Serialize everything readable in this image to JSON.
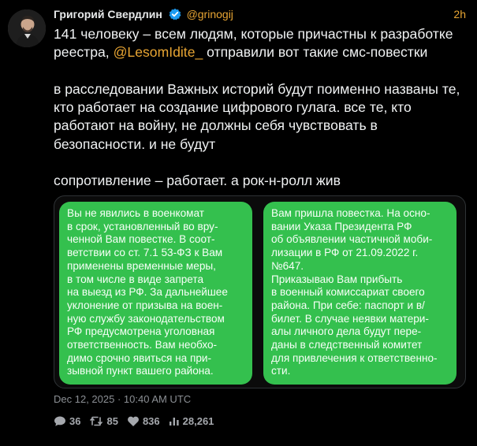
{
  "tweet": {
    "author_name": "Григорий Свердлин",
    "handle": "@grinogij",
    "time_ago": "2h",
    "text_line1_before_mention": "141 человеку – всем людям, которые причастны к разработке реестра, ",
    "mention": "@LesomIdite_",
    "text_line1_after_mention": " отправили вот такие смс-повестки",
    "paragraph2": "в расследовании Важных историй будут поименно названы те, кто работает на создание цифрового гулага. все те, кто работают на войну, не должны себя чувствовать в безопасности. и не будут",
    "paragraph3": "сопротивление – работает. а рок-н-ролл жив",
    "timestamp": "Dec 12, 2025 · 10:40 AM UTC",
    "stats": {
      "replies": "36",
      "retweets": "85",
      "likes": "836",
      "views": "28,261"
    }
  },
  "media": {
    "sms_left": "Вы не явились в военкомат\nв срок, установленный во вру-\nченной Вам  повестке. В соот-\nветствии со ст. 7.1 53-ФЗ к Вам\nприменены временные меры,\nв том числе в виде запрета\nна выезд из РФ. За дальнейшее\nуклонение от призыва на воен-\nную службу законодательством\nРФ предусмотрена уголовная\nответственность. Вам необхо-\nдимо срочно явиться на при-\nзывной пункт вашего района.",
    "sms_right": "Вам пришла повестка. На осно-\nвании Указа Президента РФ\nоб объявлении частичной моби-\nлизации в РФ от 21.09.2022 г.\n№647.\nПриказываю Вам прибыть\nв военный комиссариат своего\nрайона. При себе: паспорт и в/\nбилет. В случае неявки матери-\nалы личного дела будут пере-\nданы в следственный комитет\nдля привлечения к ответственно-\nсти."
  },
  "icons": {
    "verified": "verified-badge-icon",
    "reply": "comment-icon",
    "retweet": "retweet-icon",
    "like": "heart-icon",
    "views": "bar-chart-icon"
  },
  "colors": {
    "background": "#000000",
    "accent": "#e8a533",
    "verified": "#1d9bf0",
    "sms_bubble": "#34c04e"
  }
}
